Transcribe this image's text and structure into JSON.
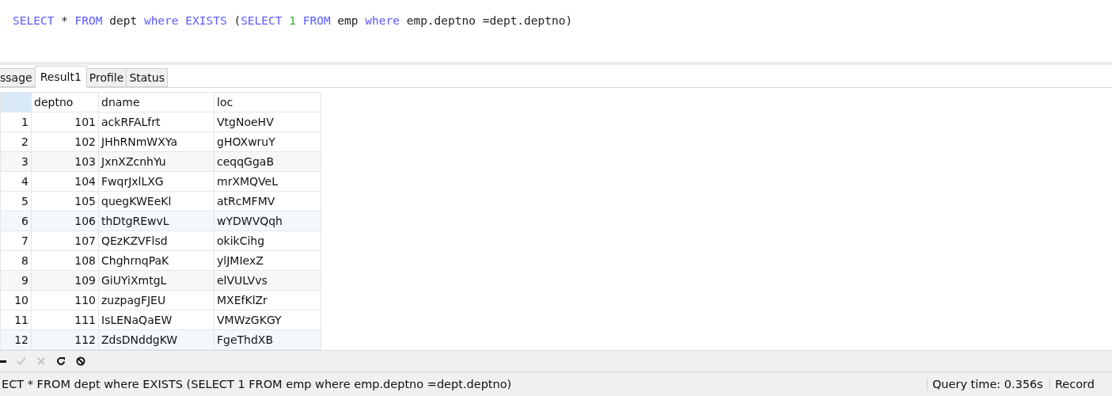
{
  "editor": {
    "tokens": [
      {
        "text": "SELECT",
        "kind": "keyword"
      },
      {
        "text": " * ",
        "kind": "plain"
      },
      {
        "text": "FROM",
        "kind": "keyword"
      },
      {
        "text": " dept ",
        "kind": "plain"
      },
      {
        "text": "where EXISTS",
        "kind": "keyword"
      },
      {
        "text": " (",
        "kind": "plain"
      },
      {
        "text": "SELECT ",
        "kind": "keyword"
      },
      {
        "text": "1 ",
        "kind": "number"
      },
      {
        "text": "FROM",
        "kind": "keyword"
      },
      {
        "text": " emp ",
        "kind": "plain"
      },
      {
        "text": "where",
        "kind": "keyword"
      },
      {
        "text": " emp.deptno =dept.deptno)",
        "kind": "plain"
      }
    ]
  },
  "tabs": [
    {
      "label": "ssage",
      "selected": false
    },
    {
      "label": "Result1",
      "selected": true
    },
    {
      "label": "Profile",
      "selected": false
    },
    {
      "label": "Status",
      "selected": false
    }
  ],
  "table": {
    "columns": [
      "deptno",
      "dname",
      "loc"
    ],
    "rows": [
      {
        "number": "1",
        "cells": [
          "101",
          "ackRFALfrt",
          "VtgNoeHV"
        ]
      },
      {
        "number": "2",
        "cells": [
          "102",
          "JHhRNmWXYa",
          "gHOXwruY"
        ]
      },
      {
        "number": "3",
        "cells": [
          "103",
          "JxnXZcnhYu",
          "ceqqGgaB"
        ]
      },
      {
        "number": "4",
        "cells": [
          "104",
          "FwqrJxlLXG",
          "mrXMQVeL"
        ]
      },
      {
        "number": "5",
        "cells": [
          "105",
          "quegKWEeKl",
          "atRcMFMV"
        ]
      },
      {
        "number": "6",
        "cells": [
          "106",
          "thDtgREwvL",
          "wYDWVQqh"
        ]
      },
      {
        "number": "7",
        "cells": [
          "107",
          "QEzKZVFlsd",
          "okikCihg"
        ]
      },
      {
        "number": "8",
        "cells": [
          "108",
          "ChghrnqPaK",
          "ylJMIexZ"
        ]
      },
      {
        "number": "9",
        "cells": [
          "109",
          "GiUYiXmtgL",
          "elVULVvs"
        ]
      },
      {
        "number": "10",
        "cells": [
          "110",
          "zuzpagFJEU",
          "MXEfKlZr"
        ]
      },
      {
        "number": "11",
        "cells": [
          "111",
          "IsLENaQaEW",
          "VMWzGKGY"
        ]
      },
      {
        "number": "12",
        "cells": [
          "112",
          "ZdsDNddgKW",
          "FgeThdXB"
        ]
      }
    ]
  },
  "toolbar": [
    {
      "kind": "delete",
      "disabled": false
    },
    {
      "kind": "apply",
      "disabled": true
    },
    {
      "kind": "cancel",
      "disabled": true
    },
    {
      "kind": "refresh",
      "disabled": false
    },
    {
      "kind": "stop",
      "disabled": false
    }
  ],
  "status_bar": {
    "query": "ECT * FROM dept where EXISTS (SELECT 1 FROM emp where emp.deptno =dept.deptno)",
    "query_time": "Query time: 0.356s",
    "record": "Record"
  }
}
